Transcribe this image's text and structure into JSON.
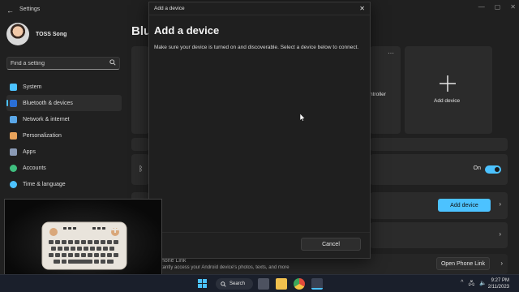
{
  "window": {
    "back_glyph": "←",
    "title": "Settings",
    "controls": {
      "minimize": "—",
      "maximize": "▢",
      "close": "✕"
    }
  },
  "profile": {
    "name": "TOSS Song"
  },
  "search": {
    "placeholder": "Find a setting",
    "icon": "search-icon"
  },
  "nav": {
    "items": [
      {
        "label": "System",
        "icon": "monitor-icon",
        "color": "#4cc2ff"
      },
      {
        "label": "Bluetooth & devices",
        "icon": "bluetooth-icon",
        "color": "#4cc2ff",
        "active": true
      },
      {
        "label": "Network & internet",
        "icon": "wifi-icon",
        "color": "#5aa7e8"
      },
      {
        "label": "Personalization",
        "icon": "brush-icon",
        "color": "#e8a25a"
      },
      {
        "label": "Apps",
        "icon": "apps-icon",
        "color": "#8a9ab5"
      },
      {
        "label": "Accounts",
        "icon": "person-icon",
        "color": "#3fbf7f"
      },
      {
        "label": "Time & language",
        "icon": "globe-icon",
        "color": "#4cc2ff"
      }
    ]
  },
  "page": {
    "title_partial": "Blu"
  },
  "cards": {
    "controller_label": "ntroller",
    "dots": "···",
    "add_device_card_label": "Add device",
    "bluetooth_state": "On",
    "add_device_button": "Add device",
    "open_phone_link_button": "Open Phone Link",
    "chevron": "›"
  },
  "phone_link": {
    "title": "hone Link",
    "desc": "tantly access your Android device's photos, texts, and more"
  },
  "dialog": {
    "bar_title": "Add a device",
    "close": "✕",
    "heading": "Add a device",
    "description": "Make sure your device is turned on and discoverable. Select a device below to connect.",
    "cancel": "Cancel"
  },
  "taskbar": {
    "search_label": "Search",
    "tray": {
      "up": "^",
      "network": "🖧",
      "speaker": "🔈"
    },
    "time": "9:27 PM",
    "date": "2/11/2023"
  },
  "colors": {
    "accent": "#4cc2ff"
  }
}
